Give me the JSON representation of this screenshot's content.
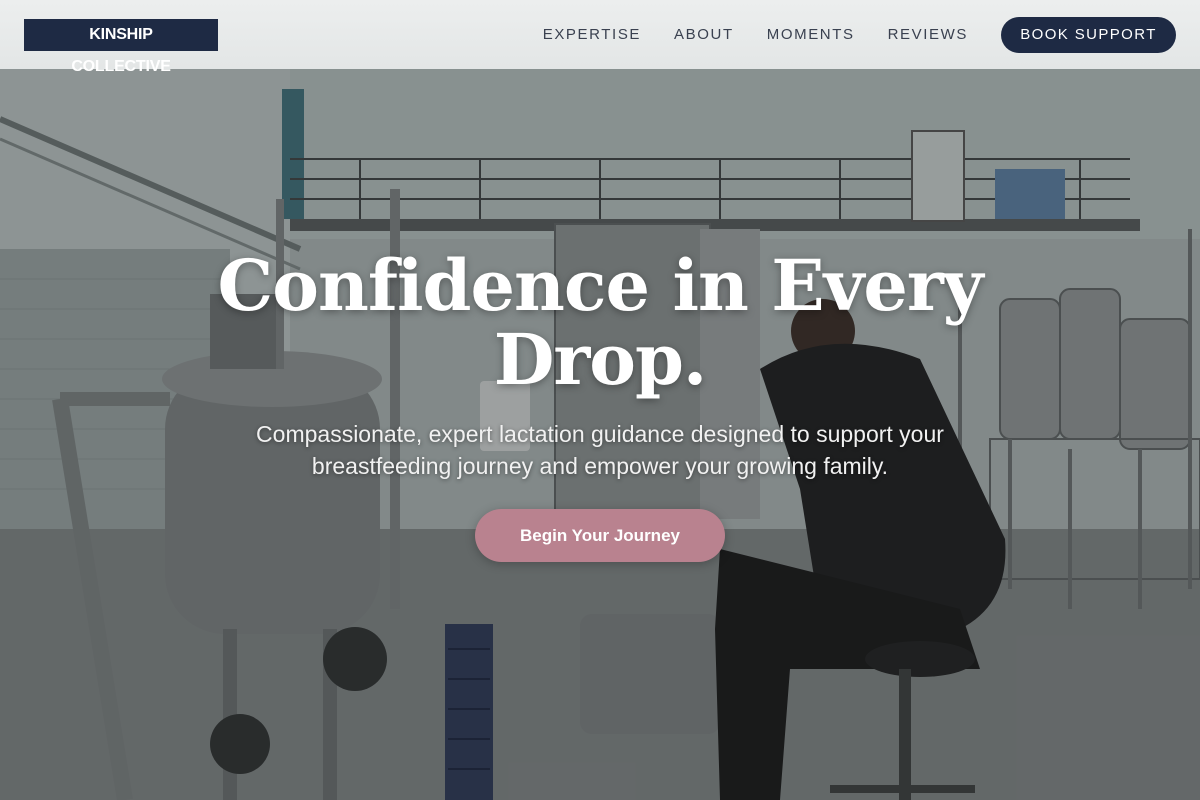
{
  "brand": {
    "logo_text": "KINSHIP COLLECTIVE"
  },
  "nav": {
    "items": [
      {
        "label": "EXPERTISE"
      },
      {
        "label": "ABOUT"
      },
      {
        "label": "MOMENTS"
      },
      {
        "label": "REVIEWS"
      }
    ],
    "cta_label": "BOOK SUPPORT"
  },
  "hero": {
    "headline": "Confidence in Every Drop.",
    "subheadline": "Compassionate, expert lactation guidance designed to support your breastfeeding journey and empower your growing family.",
    "button_label": "Begin Your Journey",
    "background_image": "industrial-dairy-facility-photo"
  },
  "colors": {
    "brand_navy": "#1e2a44",
    "accent_rose": "#b9828f",
    "header_bg": "#e3e6e6",
    "nav_text": "#3a4150"
  }
}
